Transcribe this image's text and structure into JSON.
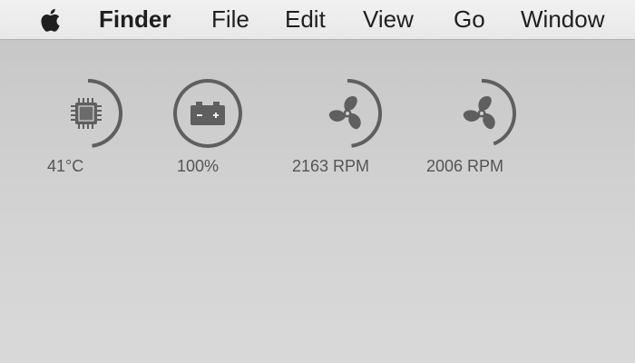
{
  "menubar": {
    "apple_icon": "apple-logo-icon",
    "app_name": "Finder",
    "items": [
      "File",
      "Edit",
      "View",
      "Go",
      "Window"
    ]
  },
  "widgets": {
    "cpu": {
      "icon": "cpu-chip-icon",
      "value": "41°C",
      "level": 0.48
    },
    "battery": {
      "icon": "battery-icon",
      "value": "100%",
      "level": 1.0
    },
    "fan1": {
      "icon": "fan-icon",
      "value": "2163 RPM",
      "level": 0.48
    },
    "fan2": {
      "icon": "fan-icon",
      "value": "2006 RPM",
      "level": 0.44
    }
  },
  "colors": {
    "gauge_stroke": "#5f5f5f",
    "label_text": "#555555",
    "menubar_bg": "#ececec"
  }
}
